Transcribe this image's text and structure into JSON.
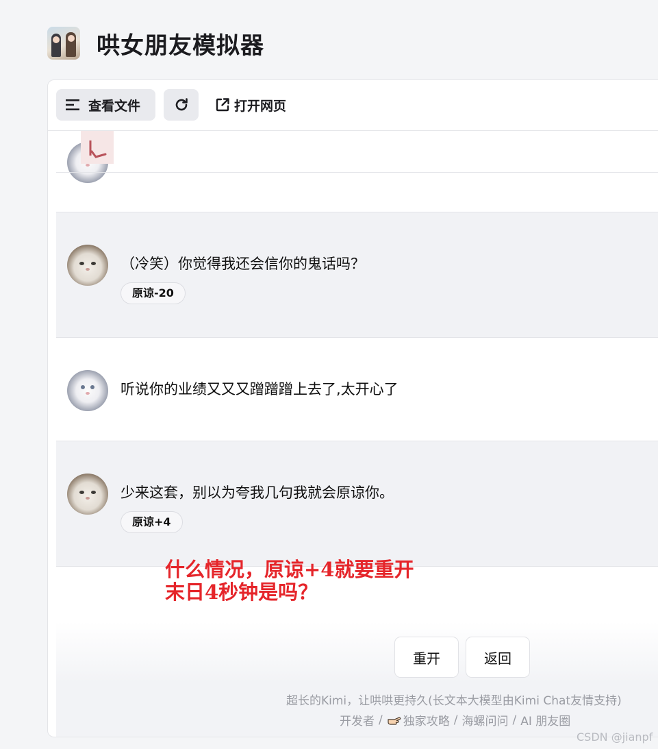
{
  "header": {
    "title": "哄女朋友模拟器",
    "icon": "app-icon"
  },
  "toolbar": {
    "files_label": "查看文件",
    "open_label": "打开网页"
  },
  "messages": [
    {
      "text": "（冷笑）你觉得我还会信你的鬼话吗？",
      "badge": "原谅-20",
      "role": "girlfriend"
    },
    {
      "text": "听说你的业绩又又又蹭蹭蹭上去了,太开心了",
      "role": "user"
    },
    {
      "text": "少来这套，别以为夸我几句我就会原谅你。",
      "badge": "原谅+4",
      "role": "girlfriend"
    }
  ],
  "annotation": {
    "line1": "什么情况，原谅+4就要重开",
    "line2": "末日4秒钟是吗？",
    "color": "#e5252a"
  },
  "actions": {
    "restart": "重开",
    "back": "返回"
  },
  "footer": {
    "line1": "超长的Kimi，让哄哄更持久(长文本大模型由Kimi Chat友情支持)",
    "links": [
      "开发者",
      "独家攻略",
      "海螺问问",
      "AI 朋友圈"
    ]
  },
  "watermark": "CSDN @jianpf"
}
